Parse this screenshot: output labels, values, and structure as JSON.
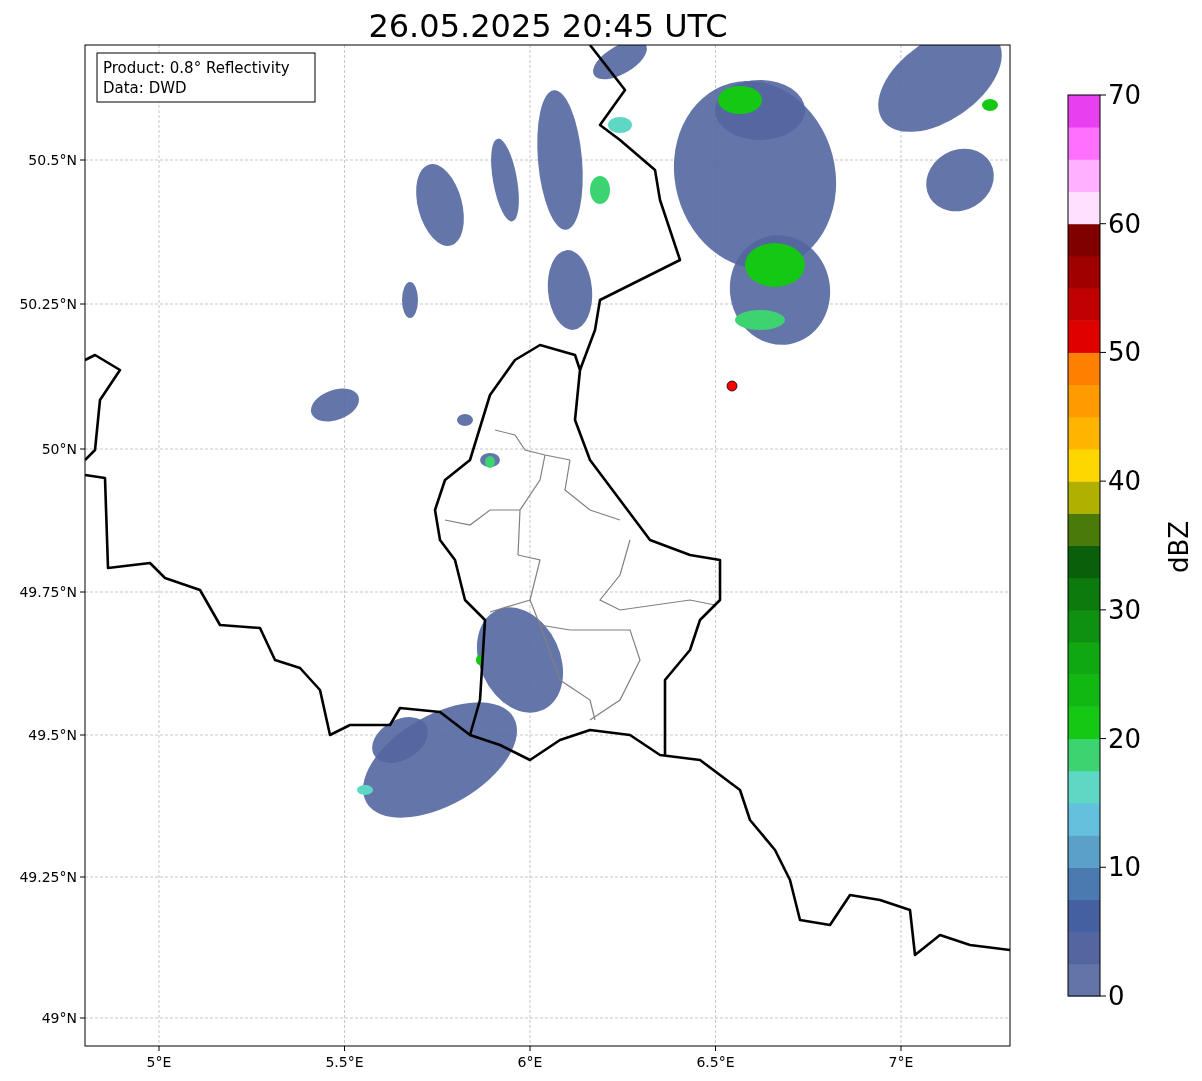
{
  "title": "26.05.2025 20:45 UTC",
  "map": {
    "annotation": [
      "Product: 0.8° Reflectivity",
      "Data: DWD"
    ],
    "yticks": [
      "50.5°N",
      "50.25°N",
      "50°N",
      "49.75°N",
      "49.5°N",
      "49.25°N",
      "49°N"
    ],
    "xticks": [
      "5°E",
      "5.5°E",
      "6°E",
      "6.5°E",
      "7°E"
    ]
  },
  "colorbar": {
    "label": "dBZ",
    "ticks": [
      "70",
      "60",
      "50",
      "40",
      "30",
      "20",
      "10",
      "0"
    ],
    "segments": [
      {
        "color": "#6474a8"
      },
      {
        "color": "#5366a0"
      },
      {
        "color": "#4460a0"
      },
      {
        "color": "#4a7ab0"
      },
      {
        "color": "#5aa0c8"
      },
      {
        "color": "#64c0dc"
      },
      {
        "color": "#5ed8c4"
      },
      {
        "color": "#3cd470"
      },
      {
        "color": "#14c814"
      },
      {
        "color": "#12b812"
      },
      {
        "color": "#10a810"
      },
      {
        "color": "#0e9010"
      },
      {
        "color": "#0c7a0c"
      },
      {
        "color": "#0a600a"
      },
      {
        "color": "#4a7a0a"
      },
      {
        "color": "#b0b000"
      },
      {
        "color": "#ffd700"
      },
      {
        "color": "#ffb400"
      },
      {
        "color": "#ff9a00"
      },
      {
        "color": "#ff8000"
      },
      {
        "color": "#e00000"
      },
      {
        "color": "#c00000"
      },
      {
        "color": "#a00000"
      },
      {
        "color": "#800000"
      },
      {
        "color": "#ffe0ff"
      },
      {
        "color": "#ffb0ff"
      },
      {
        "color": "#ff70ff"
      },
      {
        "color": "#e840f0"
      }
    ]
  }
}
